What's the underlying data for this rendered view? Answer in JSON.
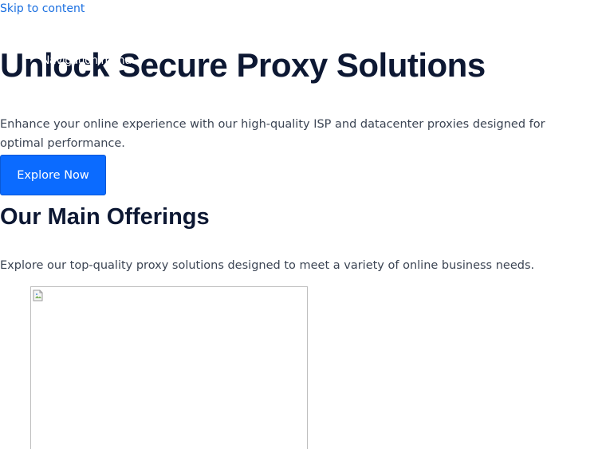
{
  "skip_link": "Skip to content",
  "hero": {
    "title": "Unlock Secure Proxy Solutions",
    "overlay_text": "Navigation menu",
    "description": "Enhance your online experience with our high-quality ISP and datacenter proxies designed for optimal performance.",
    "cta_label": "Explore Now"
  },
  "offerings": {
    "title": "Our Main Offerings",
    "description": "Explore our top-quality proxy solutions designed to meet a variety of online business needs.",
    "image_icon": "broken-image-icon"
  },
  "colors": {
    "link": "#1a6fe0",
    "heading": "#0d1833",
    "body_text": "#3b4453",
    "button": "#0b6bff"
  }
}
